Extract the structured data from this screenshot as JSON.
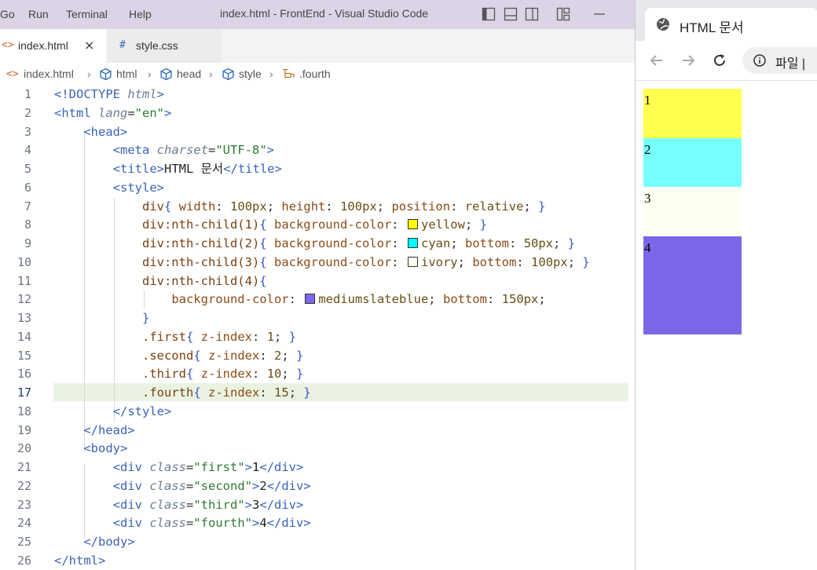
{
  "titlebar": {
    "menu": [
      "Go",
      "Run",
      "Terminal",
      "Help"
    ],
    "window_title": "index.html - FrontEnd - Visual Studio Code"
  },
  "tabs": [
    {
      "icon": "<>",
      "label": "index.html",
      "close": "×",
      "active": true
    },
    {
      "icon": "#",
      "label": "style.css",
      "active": false
    }
  ],
  "breadcrumb": [
    "index.html",
    "html",
    "head",
    "style",
    ".fourth"
  ],
  "editor": {
    "line_numbers": [
      "1",
      "2",
      "3",
      "4",
      "5",
      "6",
      "7",
      "8",
      "9",
      "10",
      "11",
      "12",
      "13",
      "14",
      "15",
      "16",
      "17",
      "18",
      "19",
      "20",
      "21",
      "22",
      "23",
      "24",
      "25",
      "26"
    ],
    "active_line": 17,
    "swatch_colors": {
      "yellow": "#ffff00",
      "cyan": "#00ffff",
      "ivory": "#fffff0",
      "mediumslateblue": "#7b68ee"
    }
  },
  "browser": {
    "tab_title": "HTML 문서",
    "address_text": "파일 |",
    "boxes": [
      {
        "label": "1",
        "color": "#ffff4d"
      },
      {
        "label": "2",
        "color": "#77ffff"
      },
      {
        "label": "3",
        "color": "#fffff2"
      },
      {
        "label": "4",
        "color": "#7b68e8"
      }
    ]
  }
}
